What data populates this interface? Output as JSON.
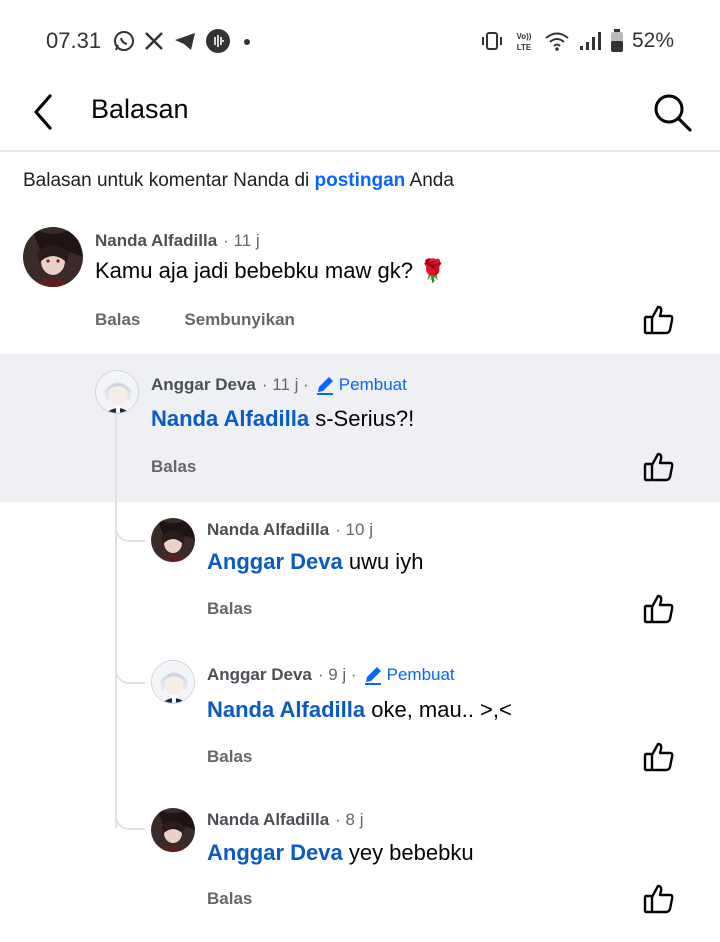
{
  "status_bar": {
    "time": "07.31",
    "battery": "52%",
    "left_icons": [
      "whatsapp-icon",
      "x-icon",
      "telegram-icon",
      "voice-icon",
      "dot-icon"
    ],
    "right_icons": [
      "vibrate-icon",
      "volte-icon",
      "wifi-icon",
      "signal-icon",
      "battery-icon"
    ]
  },
  "app_bar": {
    "title": "Balasan"
  },
  "subheader": {
    "prefix": "Balasan untuk komentar Nanda di ",
    "link": "postingan",
    "suffix": " Anda"
  },
  "comments": [
    {
      "author": "Nanda Alfadilla",
      "time": "· 11 j",
      "text": "Kamu aja jadi bebebku maw gk? 🌹",
      "actions": [
        "Balas",
        "Sembunyikan"
      ]
    },
    {
      "author": "Anggar Deva",
      "time": "· 11 j ·",
      "badge": "Pembuat",
      "mention": "Nanda Alfadilla",
      "text": " s-Serius?!",
      "actions": [
        "Balas"
      ]
    },
    {
      "author": "Nanda Alfadilla",
      "time": "· 10 j",
      "mention": "Anggar Deva",
      "text": " uwu iyh",
      "actions": [
        "Balas"
      ]
    },
    {
      "author": "Anggar Deva",
      "time": "· 9 j ·",
      "badge": "Pembuat",
      "mention": "Nanda Alfadilla",
      "text": " oke, mau.. >,<",
      "actions": [
        "Balas"
      ]
    },
    {
      "author": "Nanda Alfadilla",
      "time": "· 8 j",
      "mention": "Anggar Deva",
      "text": " yey bebebku",
      "actions": [
        "Balas"
      ]
    }
  ],
  "colors": {
    "link": "#0866ff",
    "mention": "#0a5bc4",
    "highlight_bg": "#eff0f3"
  }
}
